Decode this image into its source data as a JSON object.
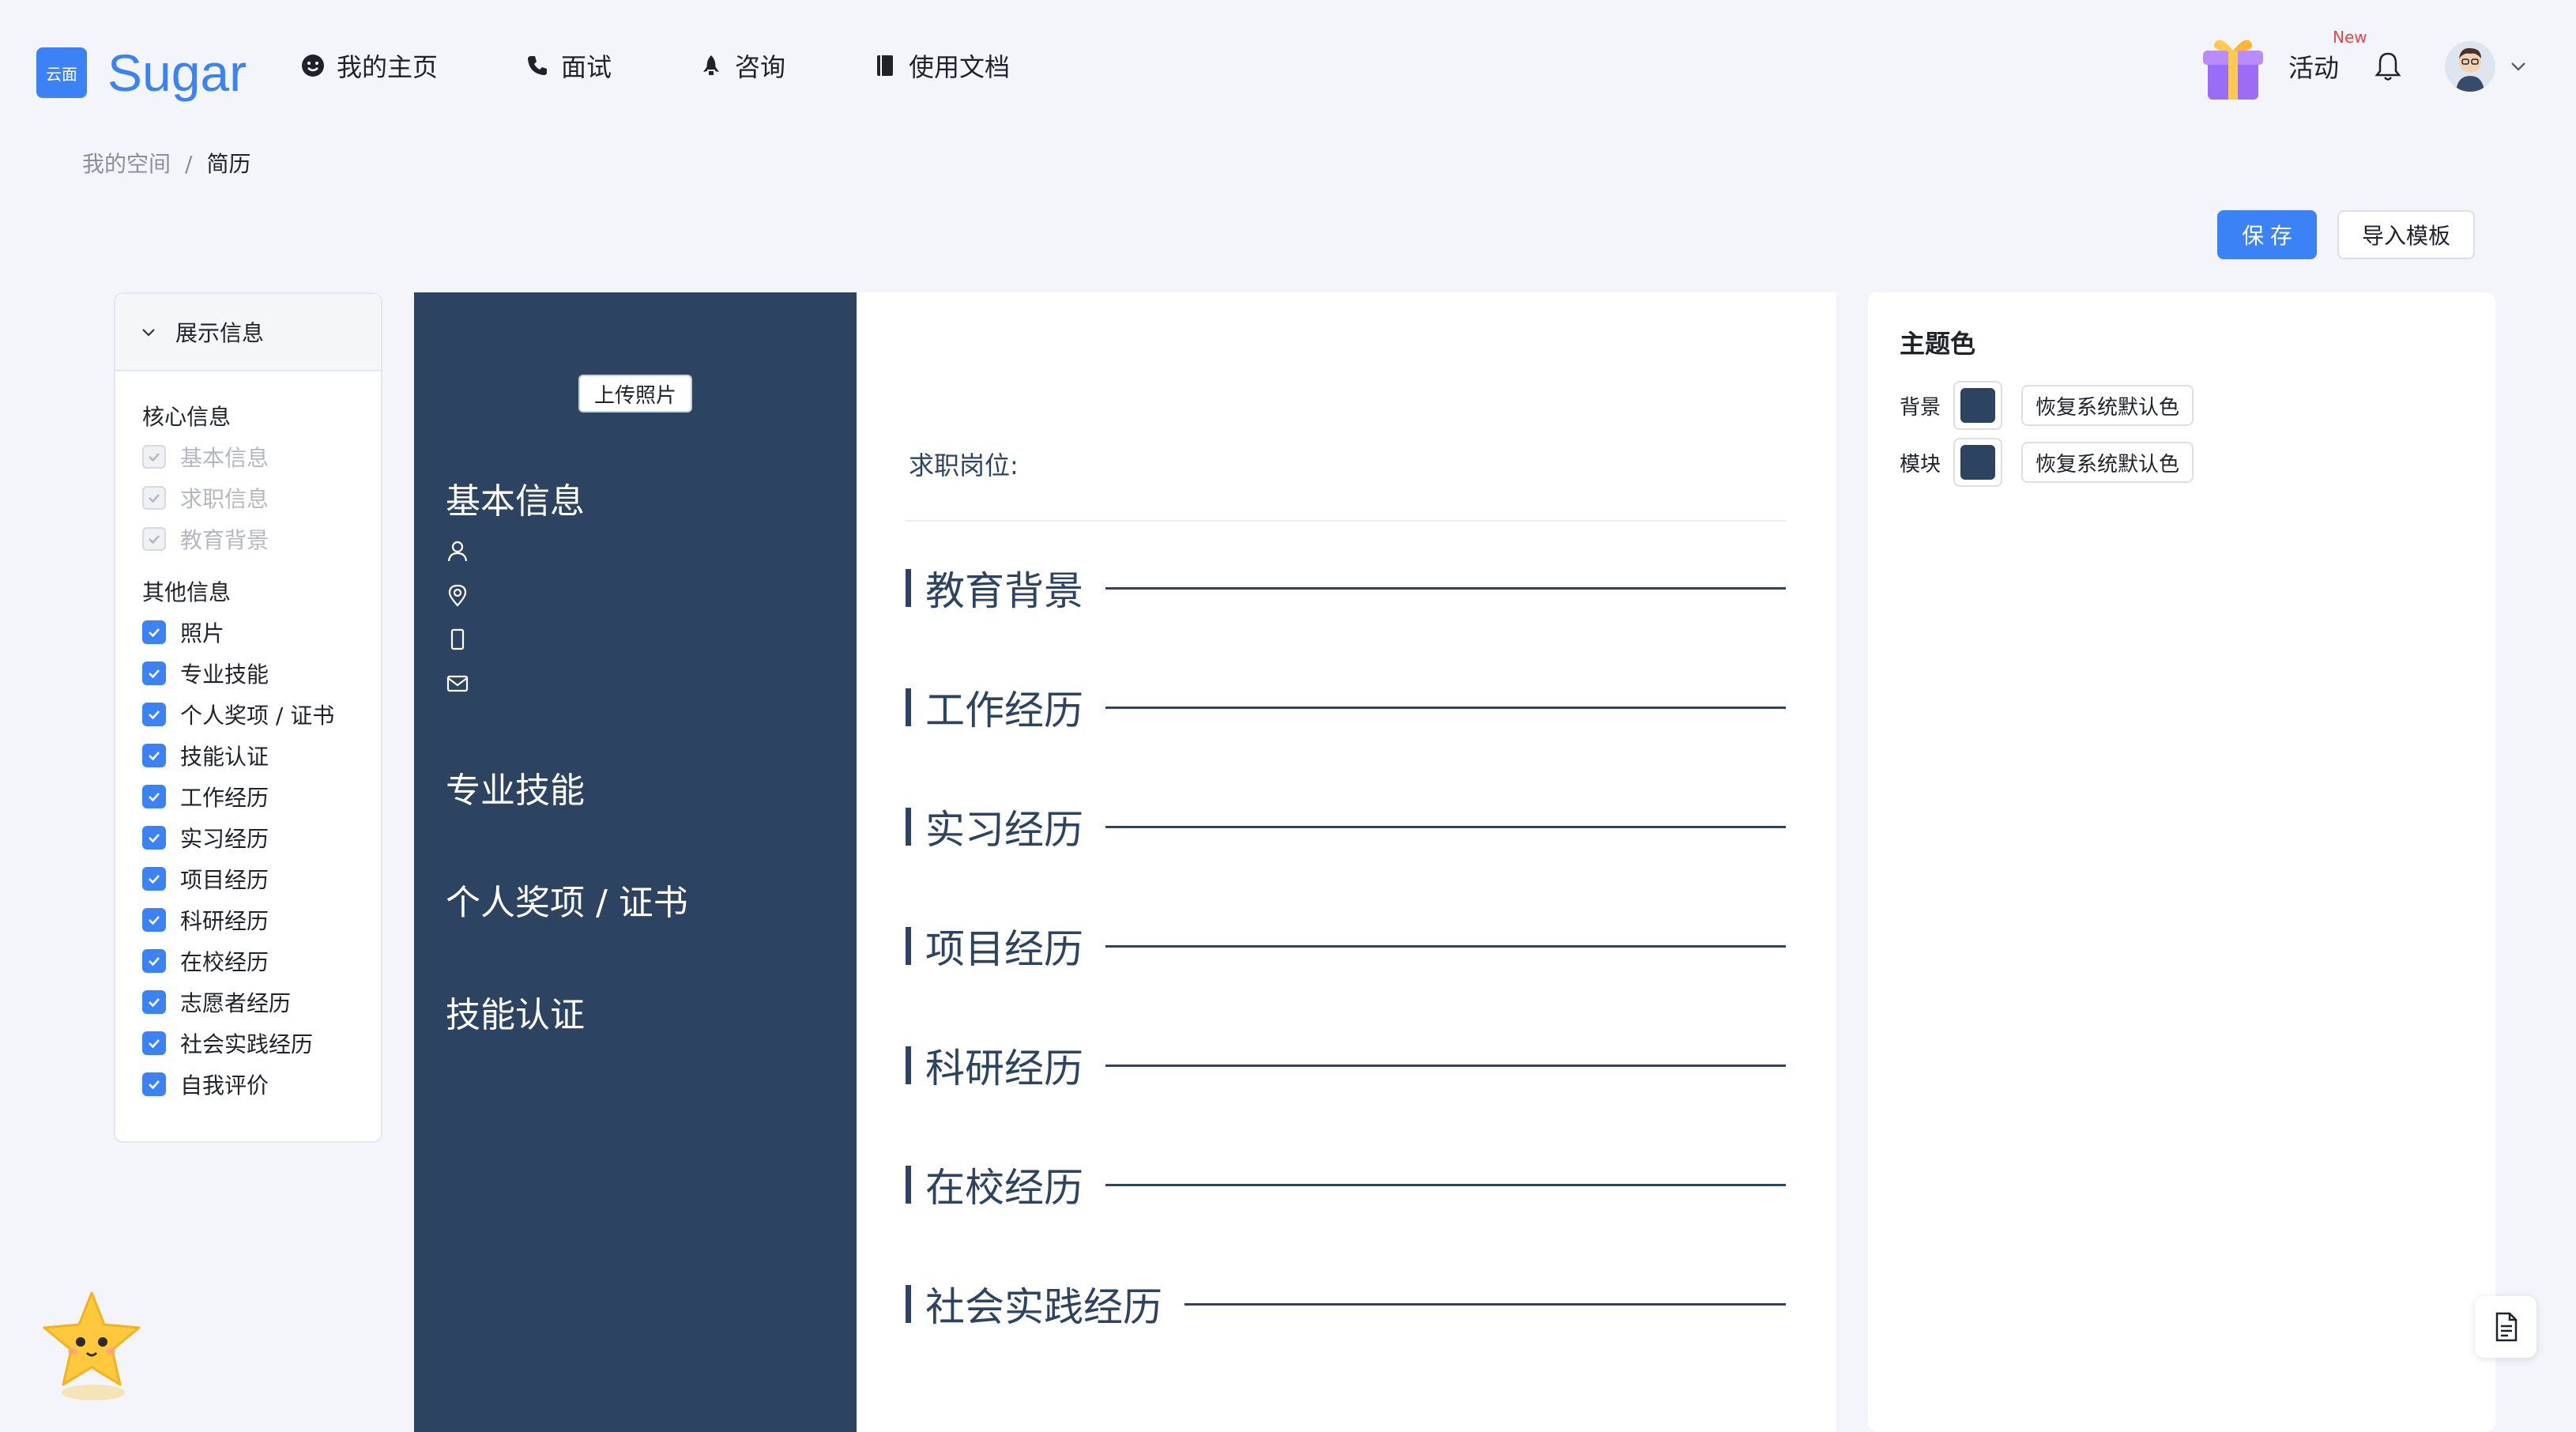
{
  "header": {
    "logo_mark": "云面",
    "logo_text": "Sugar",
    "nav": [
      {
        "label": "我的主页",
        "icon": "smile-icon"
      },
      {
        "label": "面试",
        "icon": "phone-icon"
      },
      {
        "label": "咨询",
        "icon": "rocket-icon"
      },
      {
        "label": "使用文档",
        "icon": "book-icon"
      }
    ],
    "activity_label": "活动",
    "new_badge": "New"
  },
  "breadcrumb": {
    "root": "我的空间",
    "separator": "/",
    "current": "简历"
  },
  "actions": {
    "save_label": "保 存",
    "import_label": "导入模板"
  },
  "display_panel": {
    "title": "展示信息",
    "core_title": "核心信息",
    "core_items": [
      "基本信息",
      "求职信息",
      "教育背景"
    ],
    "other_title": "其他信息",
    "other_items": [
      "照片",
      "专业技能",
      "个人奖项 / 证书",
      "技能认证",
      "工作经历",
      "实习经历",
      "项目经历",
      "科研经历",
      "在校经历",
      "志愿者经历",
      "社会实践经历",
      "自我评价"
    ]
  },
  "resume": {
    "upload_photo": "上传照片",
    "sidebar_sections": [
      "基本信息",
      "专业技能",
      "个人奖项 / 证书",
      "技能认证"
    ],
    "job_label": "求职岗位:",
    "sections": [
      "教育背景",
      "工作经历",
      "实习经历",
      "项目经历",
      "科研经历",
      "在校经历",
      "社会实践经历"
    ],
    "theme_color": "#2c4361"
  },
  "theme_panel": {
    "title": "主题色",
    "rows": [
      {
        "label": "背景",
        "color": "#2c4361",
        "restore": "恢复系统默认色"
      },
      {
        "label": "模块",
        "color": "#2c4361",
        "restore": "恢复系统默认色"
      }
    ]
  }
}
